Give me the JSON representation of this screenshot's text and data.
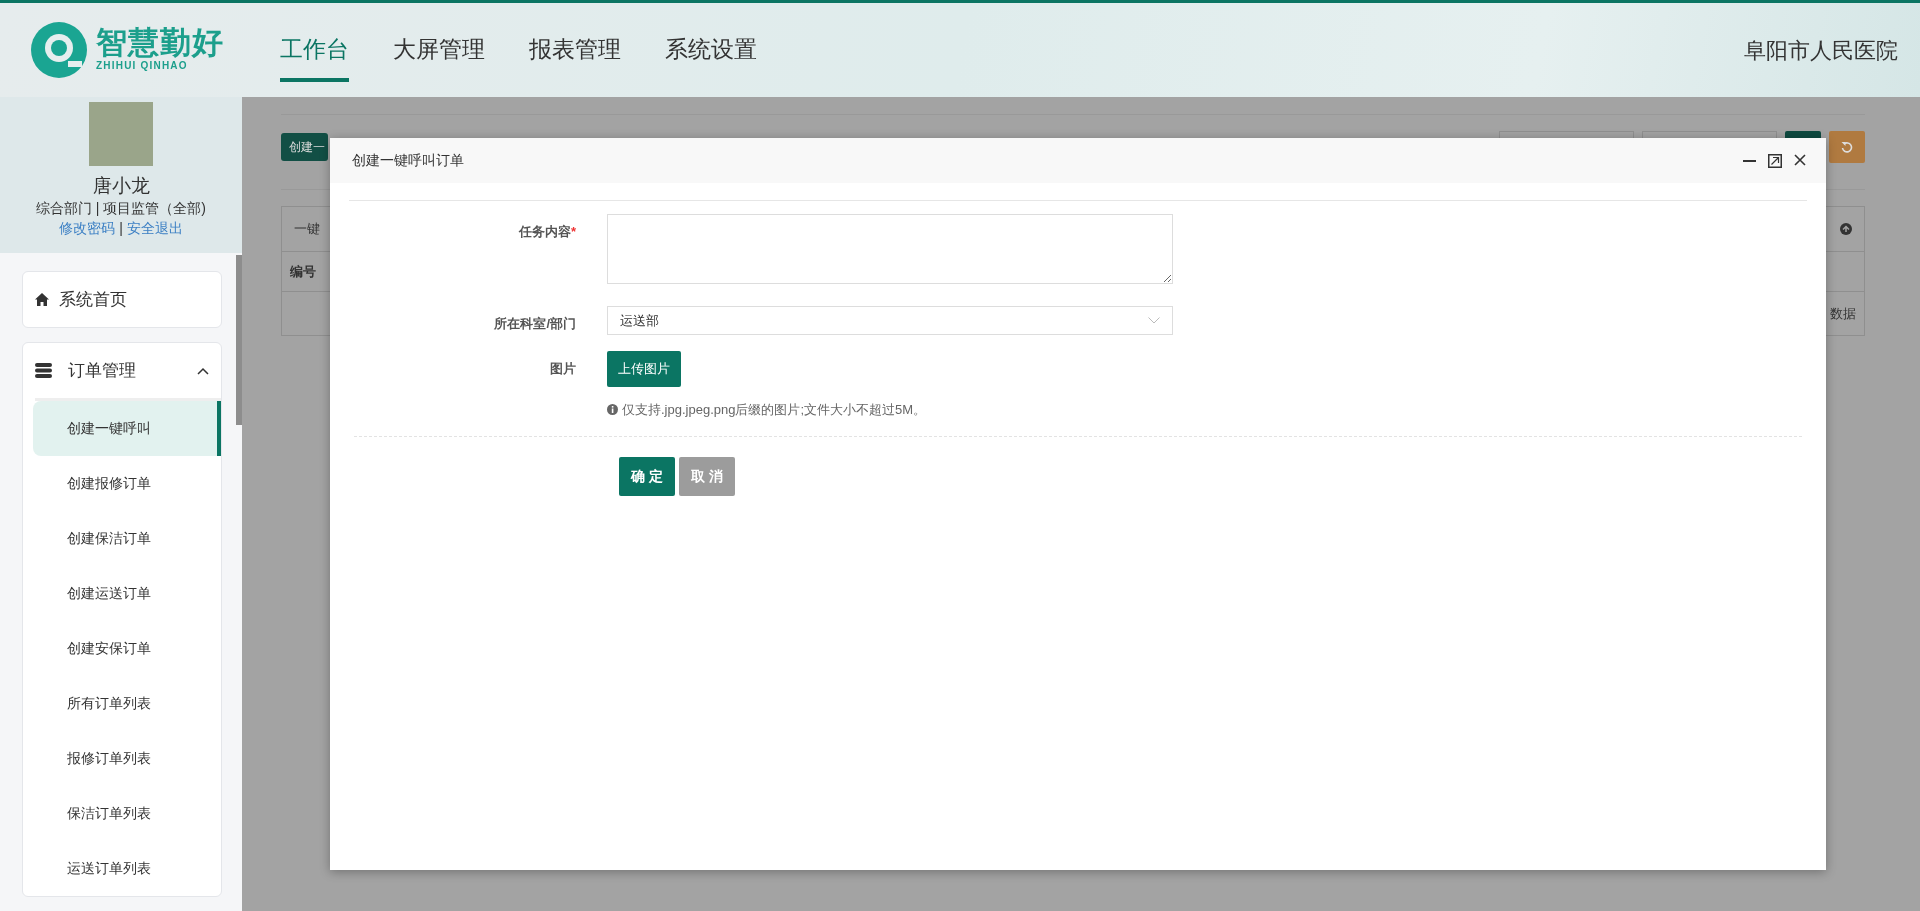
{
  "header": {
    "logo_text": "智慧勤好",
    "logo_subtext": "ZHIHUI QINHAO",
    "nav": [
      {
        "label": "工作台",
        "selected": true
      },
      {
        "label": "大屏管理",
        "selected": false
      },
      {
        "label": "报表管理",
        "selected": false
      },
      {
        "label": "系统设置",
        "selected": false
      }
    ],
    "organization": "阜阳市人民医院"
  },
  "user": {
    "name": "唐小龙",
    "role": "综合部门 | 项目监管（全部)",
    "links": [
      "修改密码",
      "安全退出"
    ],
    "link_separator": "|"
  },
  "sidebar": {
    "items": [
      {
        "label": "系统首页",
        "kind": "link"
      },
      {
        "label": "订单管理",
        "kind": "group",
        "expanded": true,
        "children": [
          {
            "label": "创建一键呼叫",
            "selected": true
          },
          {
            "label": "创建报修订单",
            "selected": false
          },
          {
            "label": "创建保洁订单",
            "selected": false
          },
          {
            "label": "创建运送订单",
            "selected": false
          },
          {
            "label": "创建安保订单",
            "selected": false
          },
          {
            "label": "所有订单列表",
            "selected": false
          },
          {
            "label": "报修订单列表",
            "selected": false
          },
          {
            "label": "保洁订单列表",
            "selected": false
          },
          {
            "label": "运送订单列表",
            "selected": false
          }
        ]
      }
    ]
  },
  "background_page": {
    "create_button": "创建一",
    "panel_title": "一键",
    "column_1": "编号",
    "empty_text": "数据"
  },
  "modal": {
    "title": "创建一键呼叫订单",
    "fields": [
      {
        "kind": "textarea",
        "label": "任务内容",
        "required_mark": "*"
      },
      {
        "kind": "select",
        "label": "所在科室/部门",
        "value": "运送部"
      },
      {
        "kind": "upload",
        "label": "图片",
        "button": "上传图片",
        "hint": "仅支持.jpg.jpeg.png后缀的图片;文件大小不超过5M。"
      }
    ],
    "buttons": [
      {
        "label": "确 定",
        "kind": "primary"
      },
      {
        "label": "取 消",
        "kind": "secondary"
      }
    ]
  }
}
